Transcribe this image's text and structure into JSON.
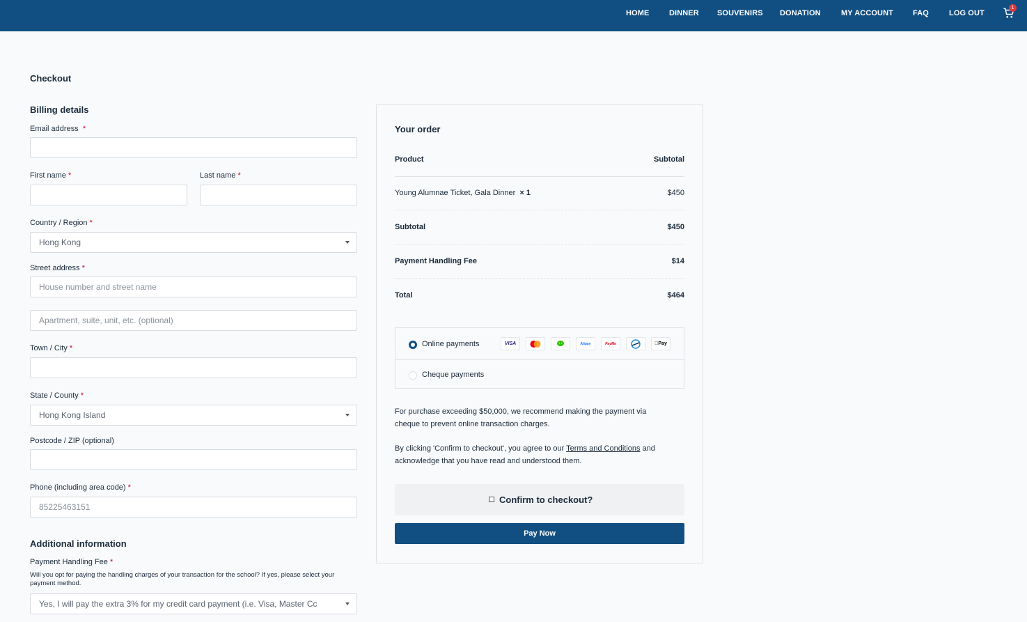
{
  "nav": {
    "home": "HOME",
    "dinner": "DINNER",
    "souvenirs": "SOUVENIRS",
    "donation": "DONATION",
    "account": "MY ACCOUNT",
    "faq": "FAQ",
    "logout": "LOG OUT",
    "cart_count": "1"
  },
  "page": {
    "title": "Checkout"
  },
  "billing": {
    "title": "Billing details",
    "email_label": "Email address",
    "first_label": "First name",
    "last_label": "Last name",
    "country_label": "Country / Region",
    "country_value": "Hong Kong",
    "street_label": "Street address",
    "street_placeholder": "House number and street name",
    "apt_placeholder": "Apartment, suite, unit, etc. (optional)",
    "city_label": "Town / City",
    "state_label": "State / County",
    "state_value": "Hong Kong Island",
    "zip_label": "Postcode / ZIP (optional)",
    "phone_label": "Phone (including area code)",
    "phone_placeholder": "85225463151",
    "required_mark": "*"
  },
  "additional": {
    "title": "Additional information",
    "fee_label": "Payment Handling Fee",
    "fee_hint": "Will you opt for paying the handling charges of your transaction for the school? If yes, please select your payment method.",
    "fee_value": "Yes, I will pay the extra 3% for my credit card payment (i.e. Visa, Master Cc"
  },
  "order": {
    "title": "Your order",
    "col_product": "Product",
    "col_subtotal": "Subtotal",
    "item_name": "Young Alumnae Ticket, Gala Dinner",
    "item_qty": "× 1",
    "item_price": "$450",
    "subtotal_label": "Subtotal",
    "subtotal_value": "$450",
    "fee_label": "Payment Handling Fee",
    "fee_value": "$14",
    "total_label": "Total",
    "total_value": "$464"
  },
  "payment": {
    "online_label": "Online payments",
    "cheque_label": "Cheque payments",
    "cards": [
      "VISA",
      "MC",
      "WeChat",
      "Alipay",
      "PayMe",
      "FPS",
      "Apple Pay"
    ],
    "card_colors": {
      "visa": "#1a1f71",
      "mc_red": "#eb001b",
      "mc_orange": "#f79e1b",
      "wechat": "#2dc100",
      "alipay": "#1677ff",
      "payme": "#db0011"
    }
  },
  "notes": {
    "large_purchase": "For purchase exceeding $50,000, we recommend making the payment via cheque to prevent online transaction charges.",
    "terms_prefix": "By clicking 'Confirm to checkout', you agree to our ",
    "terms_link": "Terms and Conditions",
    "terms_suffix": " and acknowledge that you have read and understood them."
  },
  "actions": {
    "confirm_label": "Confirm to checkout?",
    "pay_label": "Pay Now"
  }
}
